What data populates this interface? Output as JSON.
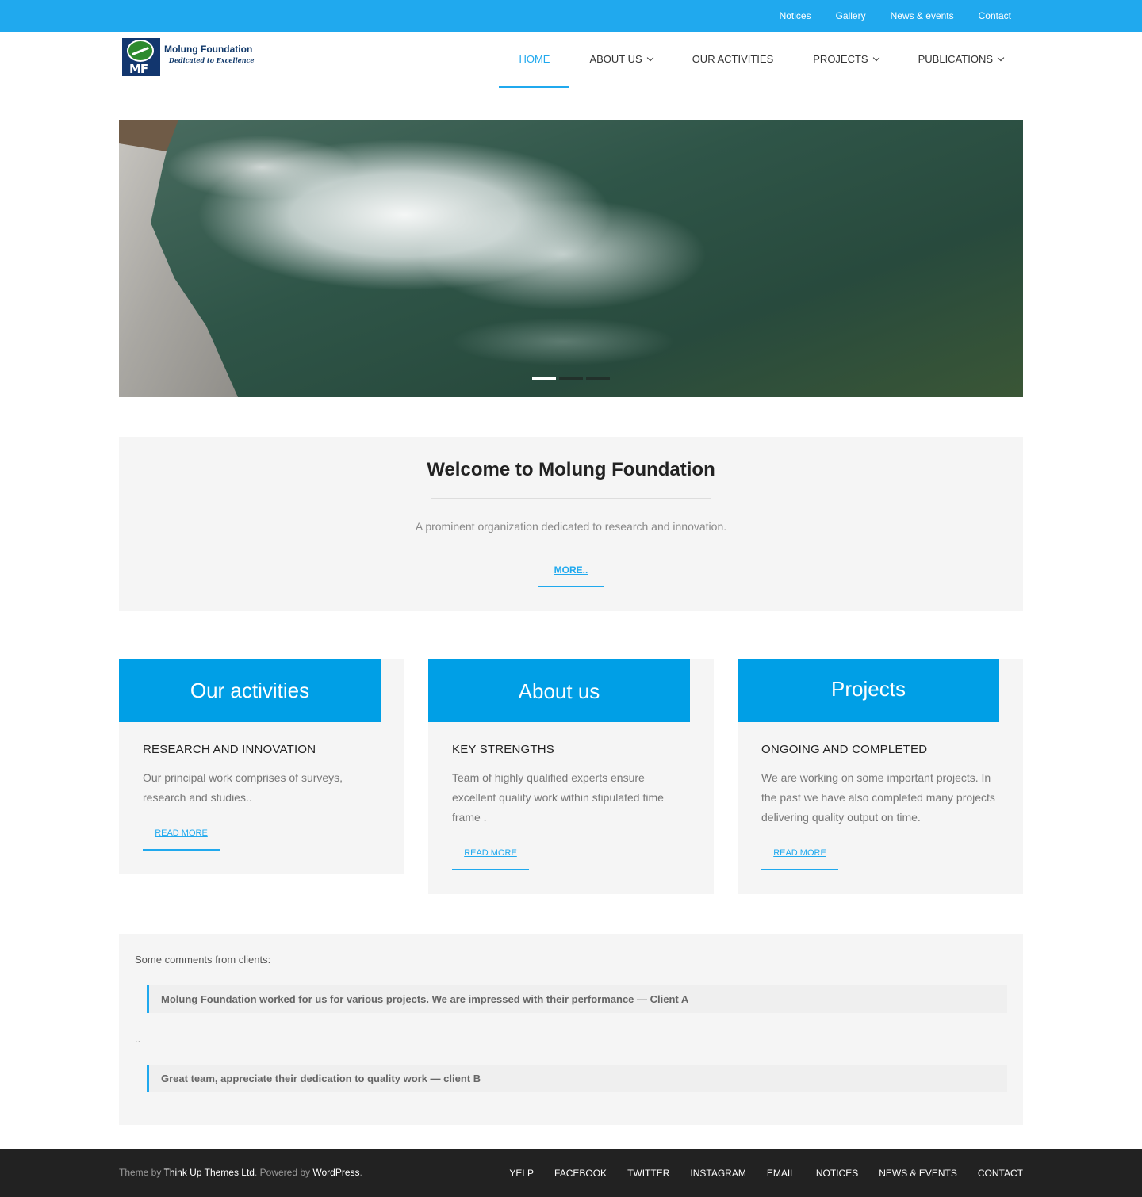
{
  "topbar": {
    "links": [
      "Notices",
      "Gallery",
      "News & events",
      "Contact"
    ]
  },
  "logo": {
    "initials": "MF",
    "name": "Molung Foundation",
    "tagline": "Dedicated to Excellence"
  },
  "mainnav": {
    "items": [
      "HOME",
      "ABOUT US",
      "OUR ACTIVITIES",
      "PROJECTS",
      "PUBLICATIONS"
    ],
    "active": "HOME"
  },
  "slider": {
    "slide_count": 3,
    "active_slide": 1
  },
  "welcome": {
    "title": "Welcome to Molung Foundation",
    "text": "A prominent organization dedicated to research and innovation.",
    "button": "MORE.."
  },
  "cards": [
    {
      "banner": "Our activities",
      "heading": "RESEARCH AND INNOVATION",
      "text": "Our principal work comprises of surveys, research and studies..",
      "button": "READ MORE"
    },
    {
      "banner": "About us",
      "heading": "KEY STRENGTHS",
      "text": "Team of highly qualified experts ensure excellent quality work within stipulated time frame .",
      "button": "READ MORE"
    },
    {
      "banner": "Projects",
      "heading": "ONGOING AND COMPLETED",
      "text": "We are working on some important projects. In the past we have also completed many projects delivering quality output on time.",
      "button": "READ MORE"
    }
  ],
  "comments": {
    "intro": "Some comments from clients:",
    "quote1": "Molung Foundation worked for us for various projects. We are impressed with their performance — Client A",
    "separator": "..",
    "quote2": "Great team, appreciate their dedication to quality work — client B"
  },
  "footer": {
    "theme_prefix": "Theme by ",
    "theme_author": "Think Up Themes Ltd",
    "powered_prefix": ". Powered by ",
    "powered_by": "WordPress",
    "suffix": ".",
    "links": [
      "YELP",
      "FACEBOOK",
      "TWITTER",
      "INSTAGRAM",
      "EMAIL",
      "NOTICES",
      "NEWS & EVENTS",
      "CONTACT"
    ]
  },
  "colors": {
    "accent": "#20a9ee",
    "card_banner": "#009fe6",
    "footer_bg": "#222222"
  }
}
